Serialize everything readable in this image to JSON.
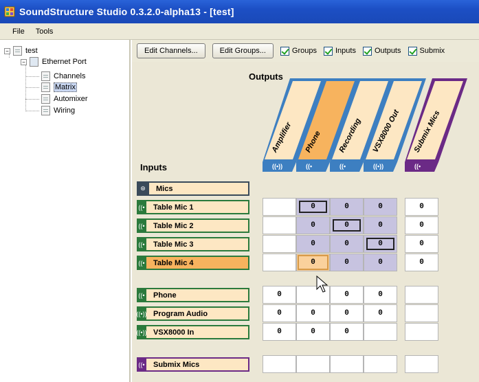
{
  "window": {
    "title": "SoundStructure Studio 0.3.2.0-alpha13 - [test]"
  },
  "menu": {
    "items": [
      "File",
      "Tools"
    ]
  },
  "tree": {
    "root": "test",
    "port": "Ethernet Port",
    "children": [
      "Channels",
      "Matrix",
      "Automixer",
      "Wiring"
    ],
    "selected": "Matrix"
  },
  "toolbar": {
    "edit_channels": "Edit Channels...",
    "edit_groups": "Edit Groups...",
    "checks": [
      {
        "label": "Groups",
        "checked": true
      },
      {
        "label": "Inputs",
        "checked": true
      },
      {
        "label": "Outputs",
        "checked": true
      },
      {
        "label": "Submix",
        "checked": true
      }
    ]
  },
  "matrix": {
    "outputs_label": "Outputs",
    "inputs_label": "Inputs",
    "outputs": [
      {
        "name": "Amplifier",
        "icon": "((•))",
        "color": "#fde7c3"
      },
      {
        "name": "Phone",
        "icon": "((•",
        "color": "#f7b35e"
      },
      {
        "name": "Recording",
        "icon": "((•",
        "color": "#fde7c3"
      },
      {
        "name": "VSX8000 Out",
        "icon": "((•))",
        "color": "#fde7c3"
      },
      {
        "name": "Submix Mics",
        "icon": "((•",
        "color": "#fde7c3"
      }
    ],
    "group": {
      "name": "Mics"
    },
    "mic_rows": [
      {
        "name": "Table Mic 1",
        "icon": "((•",
        "cells": [
          "",
          "0",
          "0",
          "0",
          "0"
        ]
      },
      {
        "name": "Table Mic 2",
        "icon": "((•",
        "cells": [
          "",
          "0",
          "0",
          "0",
          "0"
        ]
      },
      {
        "name": "Table Mic 3",
        "icon": "((•",
        "cells": [
          "",
          "0",
          "0",
          "0",
          "0"
        ]
      },
      {
        "name": "Table Mic 4",
        "icon": "((•",
        "cells": [
          "",
          "0",
          "0",
          "0",
          "0"
        ]
      }
    ],
    "remote_rows": [
      {
        "name": "Phone",
        "icon": "((•",
        "cells": [
          "0",
          "",
          "0",
          "0",
          ""
        ]
      },
      {
        "name": "Program Audio",
        "icon": "((•))",
        "cells": [
          "0",
          "0",
          "0",
          "0",
          ""
        ]
      },
      {
        "name": "VSX8000 In",
        "icon": "((•))",
        "cells": [
          "0",
          "0",
          "0",
          "",
          ""
        ]
      }
    ],
    "submix_rows": [
      {
        "name": "Submix Mics",
        "icon": "((•",
        "cells": [
          "",
          "",
          "",
          "",
          ""
        ]
      }
    ],
    "colors": {
      "green": "#2b7a3c",
      "purple": "#6b2a86",
      "blue": "#3d7fc1",
      "label_bg": "#fde7c3",
      "label_sel": "#f7b35e",
      "hilite": "#c7c3e0"
    }
  }
}
